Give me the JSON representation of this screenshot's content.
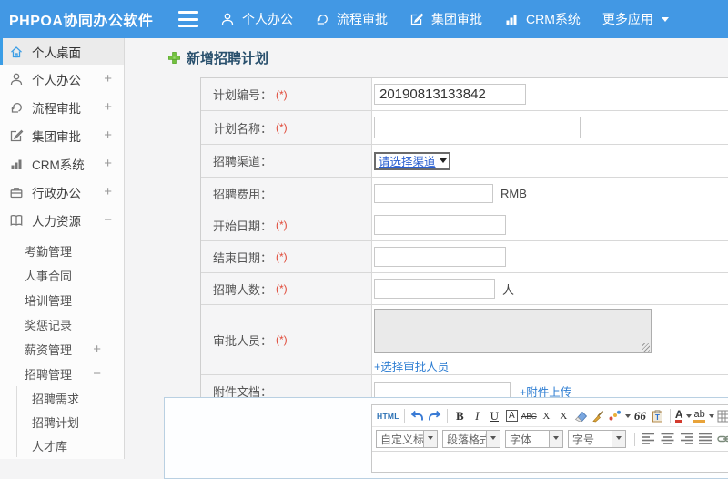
{
  "colors": {
    "topbar": "#4298e4",
    "accent": "#3a9de6",
    "link": "#2d7dd2",
    "required": "#e04b3a"
  },
  "topbar": {
    "logo": "PHPOA协同办公软件",
    "items": [
      {
        "label": "个人办公",
        "icon": "user"
      },
      {
        "label": "流程审批",
        "icon": "workflow"
      },
      {
        "label": "集团审批",
        "icon": "edit-square"
      },
      {
        "label": "CRM系统",
        "icon": "bar-chart"
      },
      {
        "label": "更多应用",
        "icon": null,
        "caret": true
      }
    ]
  },
  "sidebar": {
    "items": [
      {
        "label": "个人桌面",
        "icon": "home",
        "level": 0,
        "active": true
      },
      {
        "label": "个人办公",
        "icon": "user",
        "level": 0,
        "expand": "+"
      },
      {
        "label": "流程审批",
        "icon": "workflow",
        "level": 0,
        "expand": "+"
      },
      {
        "label": "集团审批",
        "icon": "edit-square",
        "level": 0,
        "expand": "+"
      },
      {
        "label": "CRM系统",
        "icon": "bar-chart",
        "level": 0,
        "expand": "+"
      },
      {
        "label": "行政办公",
        "icon": "briefcase",
        "level": 0,
        "expand": "+"
      },
      {
        "label": "人力资源",
        "icon": "book",
        "level": 0,
        "expand": "−"
      },
      {
        "label": "考勤管理",
        "level": 1
      },
      {
        "label": "人事合同",
        "level": 1
      },
      {
        "label": "培训管理",
        "level": 1
      },
      {
        "label": "奖惩记录",
        "level": 1
      },
      {
        "label": "薪资管理",
        "level": 1,
        "expand": "+"
      },
      {
        "label": "招聘管理",
        "level": 1,
        "expand": "−"
      },
      {
        "label": "招聘需求",
        "level": 2
      },
      {
        "label": "招聘计划",
        "level": 2
      },
      {
        "label": "人才库",
        "level": 2
      }
    ]
  },
  "page": {
    "title": "新增招聘计划"
  },
  "form": {
    "rows": [
      {
        "label": "计划编号：",
        "required": "(*)",
        "type": "text",
        "value": "20190813133842"
      },
      {
        "label": "计划名称：",
        "required": "(*)",
        "type": "text",
        "value": ""
      },
      {
        "label": "招聘渠道：",
        "type": "select",
        "value": "请选择渠道"
      },
      {
        "label": "招聘费用：",
        "type": "text",
        "value": "",
        "suffix": "RMB"
      },
      {
        "label": "开始日期：",
        "required": "(*)",
        "type": "text",
        "value": ""
      },
      {
        "label": "结束日期：",
        "required": "(*)",
        "type": "text",
        "value": ""
      },
      {
        "label": "招聘人数：",
        "required": "(*)",
        "type": "text",
        "value": "",
        "suffix": "人"
      },
      {
        "label": "审批人员：",
        "required": "(*)",
        "type": "textarea",
        "value": "",
        "link": "+选择审批人员"
      },
      {
        "label": "附件文档：",
        "type": "text",
        "value": "",
        "link": "+附件上传"
      }
    ]
  },
  "editor": {
    "row1": [
      {
        "name": "html-source",
        "text": "HTML"
      },
      {
        "name": "sep"
      },
      {
        "name": "undo"
      },
      {
        "name": "redo"
      },
      {
        "name": "sep"
      },
      {
        "name": "bold",
        "text": "B"
      },
      {
        "name": "italic",
        "text": "I"
      },
      {
        "name": "underline",
        "text": "U"
      },
      {
        "name": "char-border",
        "text": "A"
      },
      {
        "name": "strikethrough",
        "text": "ABC"
      },
      {
        "name": "superscript",
        "text": "X",
        "sup": "2"
      },
      {
        "name": "subscript",
        "text": "X",
        "sub": "2"
      },
      {
        "name": "eraser"
      },
      {
        "name": "format-brush"
      },
      {
        "name": "special-symbol",
        "dropdown": true
      },
      {
        "name": "blockquote",
        "text": "66"
      },
      {
        "name": "paste-plain"
      },
      {
        "name": "sep"
      },
      {
        "name": "font-color",
        "text": "A",
        "dropdown": true
      },
      {
        "name": "back-color",
        "text": "ab",
        "dropdown": true
      },
      {
        "name": "insert-table"
      }
    ],
    "selects": [
      {
        "name": "custom-title",
        "label": "自定义标题"
      },
      {
        "name": "paragraph-format",
        "label": "段落格式"
      },
      {
        "name": "font-family",
        "label": "字体"
      },
      {
        "name": "font-size",
        "label": "字号"
      }
    ],
    "row2_icons": [
      "align-left",
      "align-center",
      "align-right",
      "align-justify",
      "insert-link",
      "unlink"
    ]
  }
}
